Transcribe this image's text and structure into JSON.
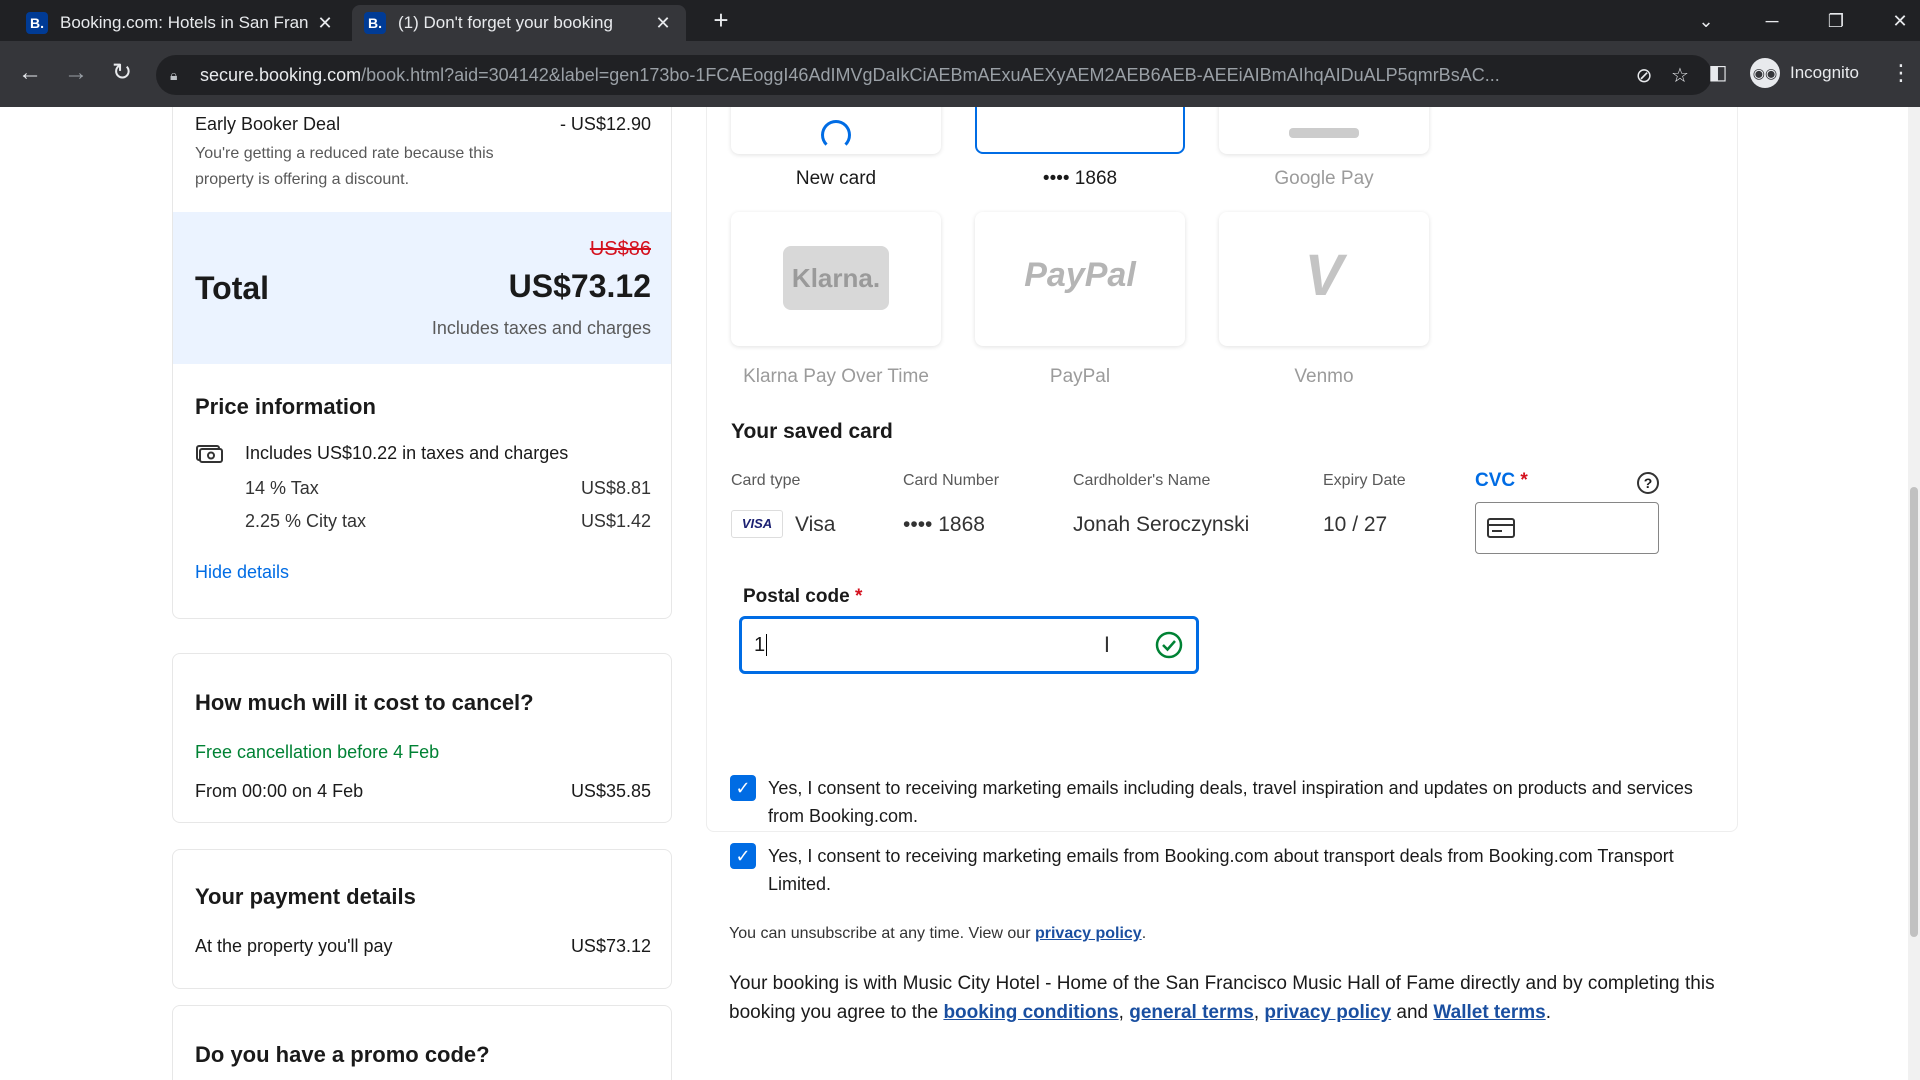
{
  "browser": {
    "tabs": [
      {
        "favicon": "B.",
        "title": "Booking.com: Hotels in San Fran",
        "close": "✕"
      },
      {
        "favicon": "B.",
        "title": "(1) Don't forget your booking",
        "close": "✕"
      }
    ],
    "new_tab": "+",
    "url_host": "secure.booking.com",
    "url_path": "/book.html?aid=304142&label=gen173bo-1FCAEoggI46AdIMVgDaIkCiAEBmAExuAEXyAEM2AEB6AEB-AEEiAIBmAIhqAIDuALP5qmrBsAC...",
    "incognito_label": "Incognito",
    "icons": {
      "back": "arrow-left-icon",
      "forward": "arrow-right-icon",
      "reload": "reload-icon",
      "lock": "lock-icon",
      "eye_off": "eye-off-icon",
      "star": "star-icon",
      "sidepanel": "side-panel-icon",
      "menu": "kebab-menu-icon"
    }
  },
  "summary": {
    "early_booker": {
      "label": "Early Booker Deal",
      "amount": "- US$12.90",
      "note": "You're getting a reduced rate because this property is offering a discount."
    },
    "total": {
      "label": "Total",
      "old_price": "US$86",
      "price": "US$73.12",
      "note": "Includes taxes and charges"
    },
    "price_info": {
      "title": "Price information",
      "includes": "Includes US$10.22 in taxes and charges",
      "lines": [
        {
          "label": "14 % Tax",
          "amount": "US$8.81"
        },
        {
          "label": "2.25 % City tax",
          "amount": "US$1.42"
        }
      ],
      "hide_details": "Hide details"
    },
    "cancel": {
      "title": "How much will it cost to cancel?",
      "free": "Free cancellation before 4 Feb",
      "from_label": "From 00:00 on 4 Feb",
      "from_amount": "US$35.85"
    },
    "payment": {
      "title": "Your payment details",
      "label": "At the property you'll pay",
      "amount": "US$73.12"
    },
    "promo": {
      "title": "Do you have a promo code?"
    }
  },
  "payment_methods": {
    "top_row": [
      {
        "label": "New card"
      },
      {
        "label": "•••• 1868"
      },
      {
        "label": "Google Pay"
      }
    ],
    "second_row": [
      {
        "logo": "Klarna.",
        "label": "Klarna Pay Over Time"
      },
      {
        "logo": "PayPal",
        "label": "PayPal"
      },
      {
        "logo": "V",
        "label": "Venmo"
      }
    ]
  },
  "saved_card": {
    "title": "Your saved card",
    "headers": {
      "type": "Card type",
      "number": "Card Number",
      "name": "Cardholder's Name",
      "expiry": "Expiry Date",
      "cvc": "CVC",
      "required": "*"
    },
    "values": {
      "type_badge": "VISA",
      "type": "Visa",
      "number": "•••• 1868",
      "name": "Jonah Seroczynski",
      "expiry": "10 / 27"
    },
    "help": "?",
    "cvc_value": ""
  },
  "postal": {
    "label": "Postal code",
    "required": "*",
    "value": "1"
  },
  "consents": [
    {
      "checked": true,
      "text": "Yes, I consent to receiving marketing emails including deals, travel inspiration and updates on products and services from Booking.com."
    },
    {
      "checked": true,
      "text": "Yes, I consent to receiving marketing emails from Booking.com about transport deals from Booking.com Transport Limited."
    }
  ],
  "unsubscribe": {
    "text": "You can unsubscribe at any time. View our",
    "link": "privacy policy",
    "end": "."
  },
  "terms": {
    "text": "Your booking is with Music City Hotel - Home of the San Francisco Music Hall of Fame directly and by completing this booking you agree to the",
    "link1": "booking conditions",
    "sep1": ",",
    "link2": "general terms",
    "sep2": ",",
    "link3": "privacy policy",
    "and": "and",
    "link4": "Wallet terms",
    "end": "."
  },
  "colors": {
    "brand": "#003b95",
    "link": "#006ce4",
    "success": "#008234",
    "strike": "#d4111e"
  }
}
